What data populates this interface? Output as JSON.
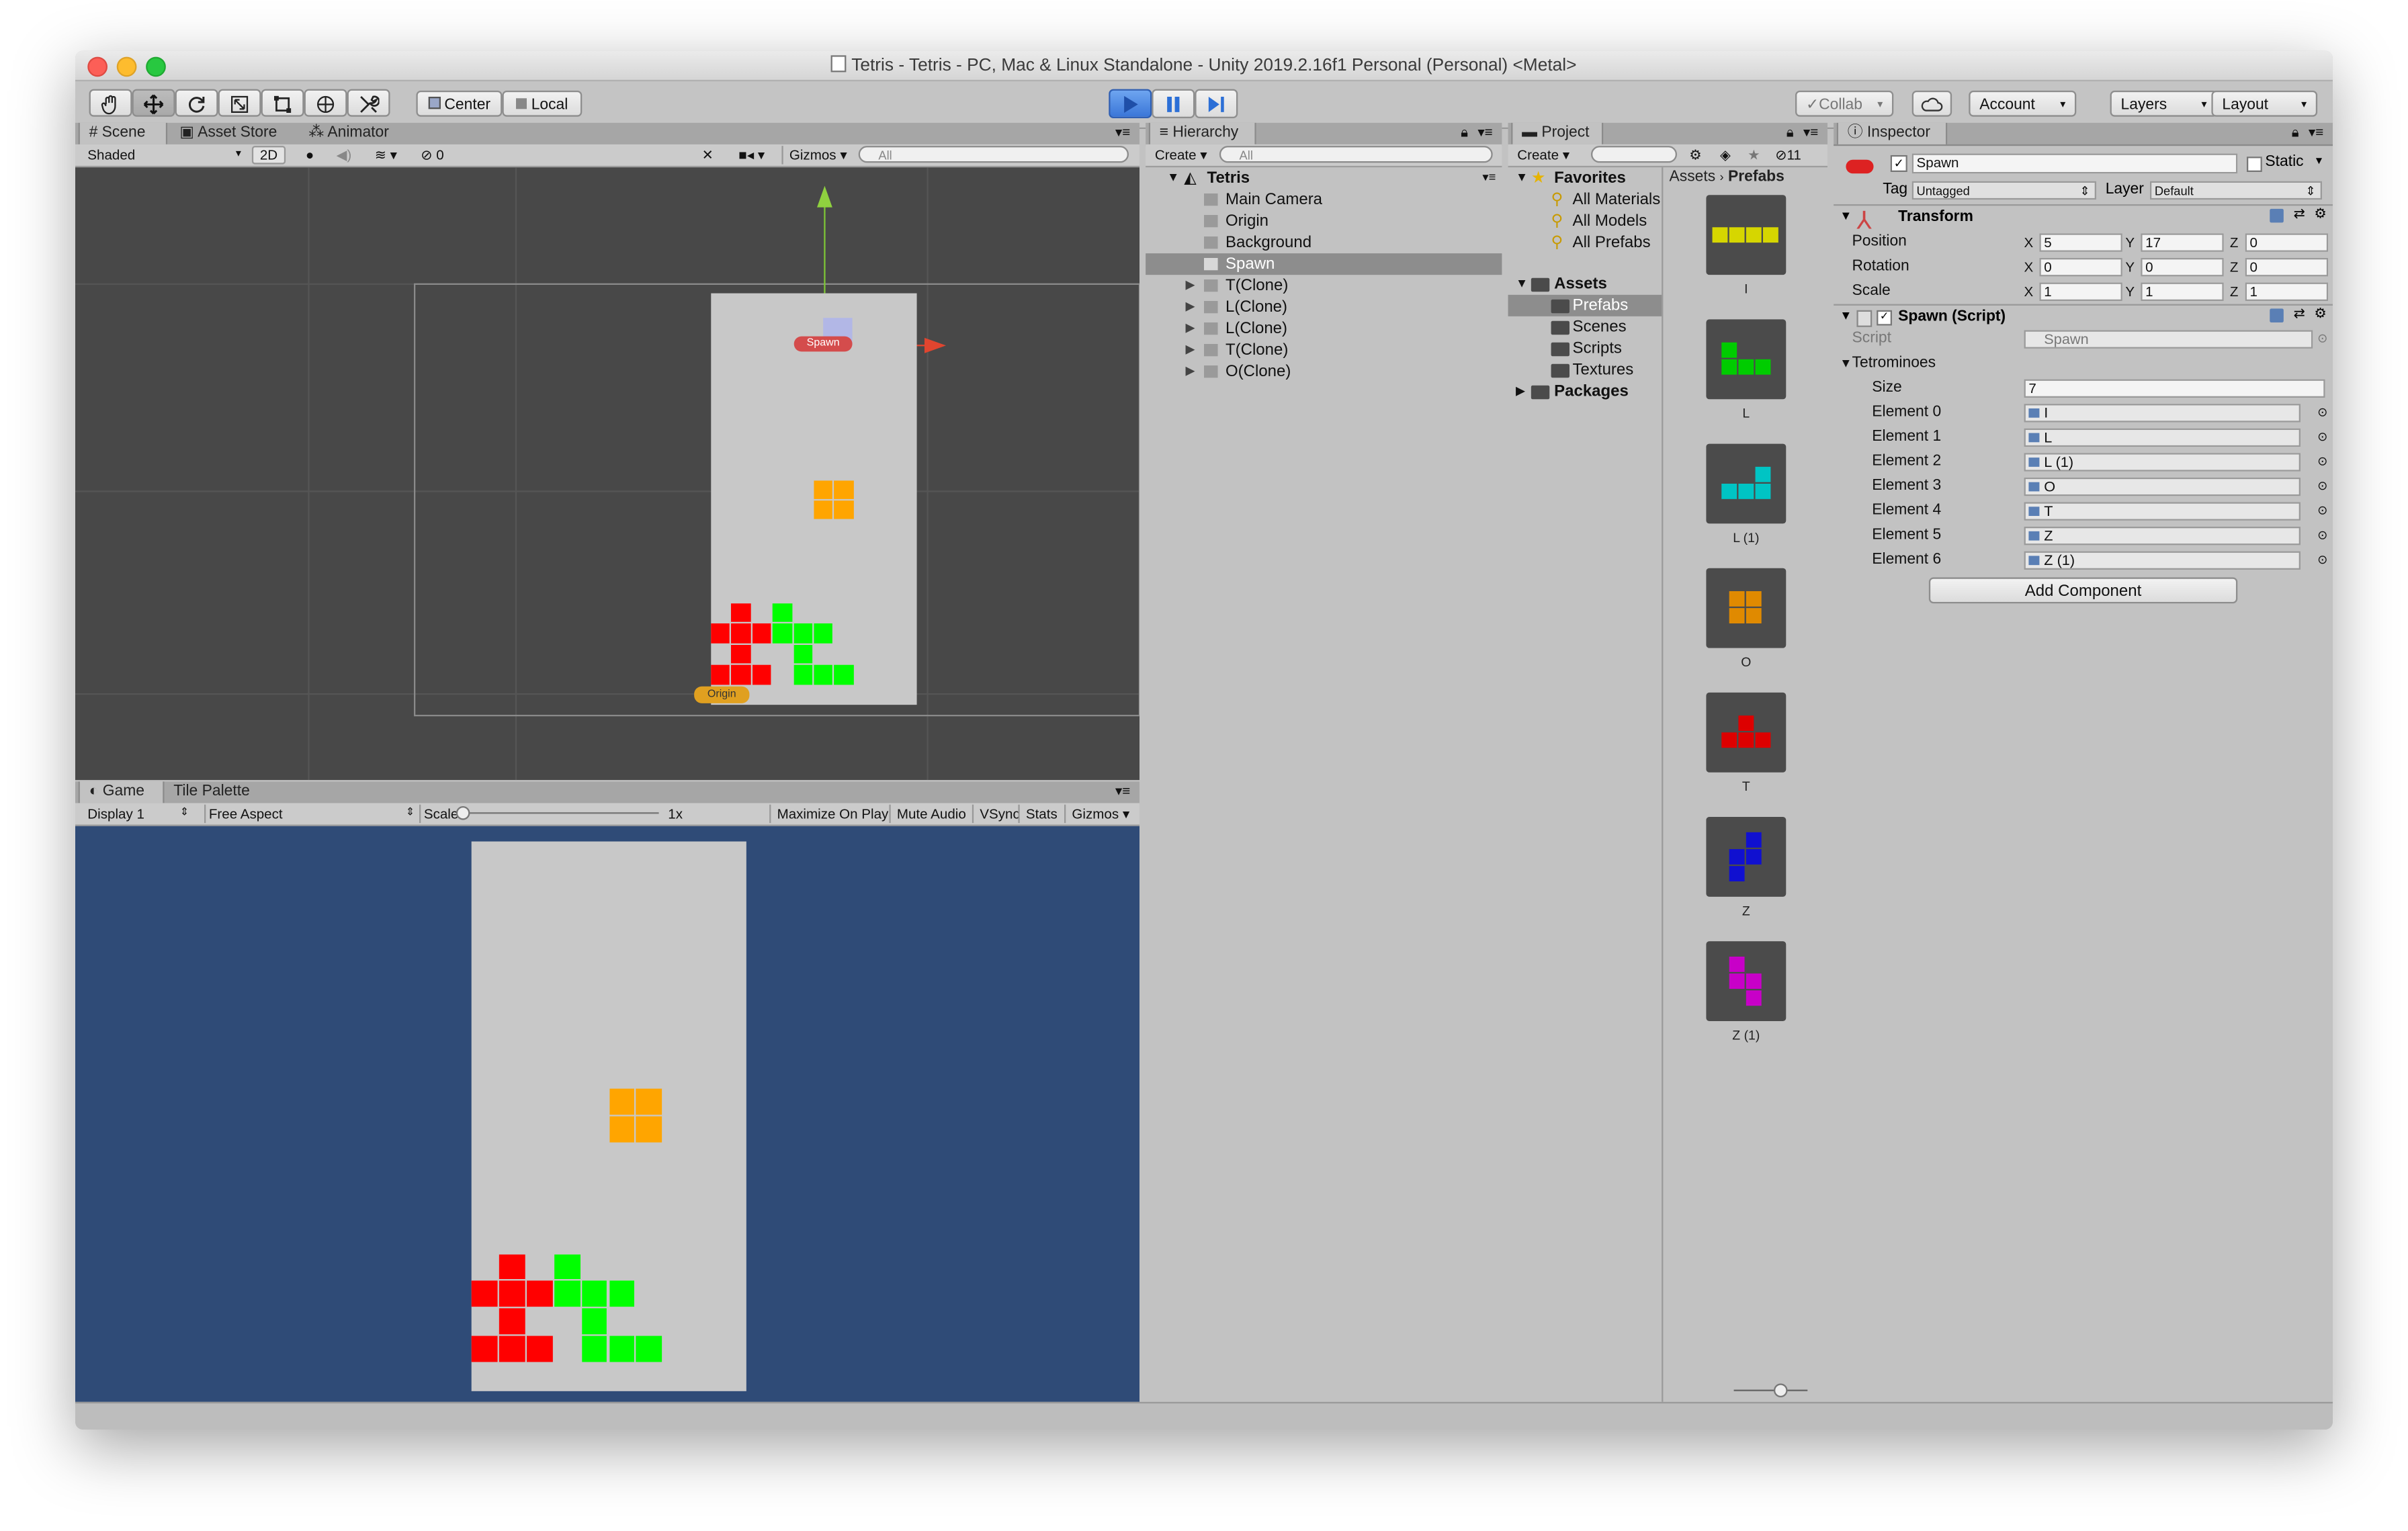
{
  "window": {
    "title": "Tetris - Tetris - PC, Mac & Linux Standalone - Unity 2019.2.16f1 Personal (Personal) <Metal>"
  },
  "toolbar": {
    "tools": [
      "hand-tool",
      "move-tool",
      "rotate-tool",
      "scale-tool",
      "rect-tool",
      "transform-tool",
      "custom-tool"
    ],
    "pivot_center": "Center",
    "pivot_local": "Local",
    "collab": "Collab",
    "account": "Account",
    "layers": "Layers",
    "layout": "Layout"
  },
  "scene": {
    "tabs": [
      "Scene",
      "Asset Store",
      "Animator"
    ],
    "shading": "Shaded",
    "mode_2d": "2D",
    "hidden_count": "0",
    "gizmos": "Gizmos",
    "search_placeholder": "All",
    "labels": {
      "spawn": "Spawn",
      "origin": "Origin"
    }
  },
  "game": {
    "tabs": [
      "Game",
      "Tile Palette"
    ],
    "display": "Display 1",
    "aspect": "Free Aspect",
    "scale_label": "Scale",
    "scale_value": "1x",
    "maximize": "Maximize On Play",
    "mute": "Mute Audio",
    "vsync": "VSync",
    "stats": "Stats",
    "gizmos": "Gizmos"
  },
  "hierarchy": {
    "tab": "Hierarchy",
    "create": "Create",
    "search_placeholder": "All",
    "scene_name": "Tetris",
    "items": [
      {
        "label": "Main Camera",
        "expandable": false,
        "selected": false
      },
      {
        "label": "Origin",
        "expandable": false,
        "selected": false
      },
      {
        "label": "Background",
        "expandable": false,
        "selected": false
      },
      {
        "label": "Spawn",
        "expandable": false,
        "selected": true
      },
      {
        "label": "T(Clone)",
        "expandable": true,
        "selected": false
      },
      {
        "label": "L(Clone)",
        "expandable": true,
        "selected": false
      },
      {
        "label": "L(Clone)",
        "expandable": true,
        "selected": false
      },
      {
        "label": "T(Clone)",
        "expandable": true,
        "selected": false
      },
      {
        "label": "O(Clone)",
        "expandable": true,
        "selected": false
      }
    ]
  },
  "project": {
    "tab": "Project",
    "create": "Create",
    "hidden_count": "11",
    "favorites": "Favorites",
    "favorite_items": [
      "All Materials",
      "All Models",
      "All Prefabs"
    ],
    "assets": "Assets",
    "asset_folders": [
      "Prefabs",
      "Scenes",
      "Scripts",
      "Textures"
    ],
    "packages": "Packages",
    "breadcrumb": [
      "Assets",
      "Prefabs"
    ],
    "prefabs": [
      {
        "name": "I",
        "color": "#d6d600"
      },
      {
        "name": "L",
        "color": "#00cc00"
      },
      {
        "name": "L (1)",
        "color": "#00c4c4"
      },
      {
        "name": "O",
        "color": "#e08a00"
      },
      {
        "name": "T",
        "color": "#dd0000"
      },
      {
        "name": "Z",
        "color": "#1010d0"
      },
      {
        "name": "Z (1)",
        "color": "#c800c8"
      }
    ]
  },
  "inspector": {
    "tab": "Inspector",
    "object_name": "Spawn",
    "static_label": "Static",
    "tag_label": "Tag",
    "tag_value": "Untagged",
    "layer_label": "Layer",
    "layer_value": "Default",
    "transform": {
      "title": "Transform",
      "position": {
        "label": "Position",
        "x": "5",
        "y": "17",
        "z": "0"
      },
      "rotation": {
        "label": "Rotation",
        "x": "0",
        "y": "0",
        "z": "0"
      },
      "scale": {
        "label": "Scale",
        "x": "1",
        "y": "1",
        "z": "1"
      }
    },
    "script": {
      "title": "Spawn (Script)",
      "script_label": "Script",
      "script_value": "Spawn",
      "array_label": "Tetrominoes",
      "size_label": "Size",
      "size_value": "7",
      "elements": [
        {
          "label": "Element 0",
          "value": "I"
        },
        {
          "label": "Element 1",
          "value": "L"
        },
        {
          "label": "Element 2",
          "value": "L (1)"
        },
        {
          "label": "Element 3",
          "value": "O"
        },
        {
          "label": "Element 4",
          "value": "T"
        },
        {
          "label": "Element 5",
          "value": "Z"
        },
        {
          "label": "Element 6",
          "value": "Z (1)"
        }
      ]
    },
    "add_component": "Add Component"
  },
  "colors": {
    "red_block": "#ff0000",
    "green_block": "#00ff00",
    "orange_block": "#ffa500",
    "game_bg": "#2f4b77",
    "board": "#c8c8c8",
    "scene_bg": "#484848"
  }
}
